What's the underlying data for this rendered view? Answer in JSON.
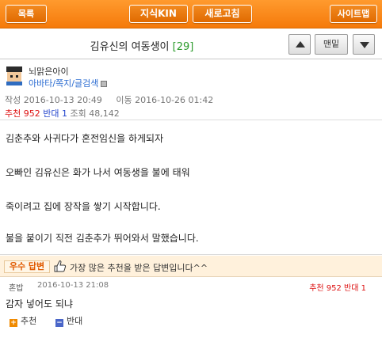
{
  "topbar": {
    "list_label": "목록",
    "kin_label": "지식KIN",
    "refresh_label": "새로고침",
    "sitemap_label": "사이트맵"
  },
  "post": {
    "title": "김유신의 여동생이",
    "comment_count": "[29]",
    "nav_top_label": "맨밑",
    "author": "뇌맑은아이",
    "author_links": "아바타/쪽지/글검색",
    "written_label": "작성",
    "written_date": "2016-10-13 20:49",
    "moved_label": "이동",
    "moved_date": "2016-10-26 01:42",
    "recommend_label": "추천",
    "recommend_count": "952",
    "oppose_label": "반대",
    "oppose_count": "1",
    "views_label": "조회",
    "views_count": "48,142",
    "paragraphs": [
      "김춘추와 사귀다가 혼전임신을 하게되자",
      "오빠인 김유신은 화가 나서 여동생을 불에 태워",
      "죽이려고 집에 장작을 쌓기 시작합니다.",
      "불을 붙이기 직전 김춘추가 뛰어와서 말했습니다."
    ]
  },
  "best": {
    "badge": "우수 답변",
    "text": "가장 많은 추천을 받은 답변입니다^^"
  },
  "reply": {
    "author": "혼밥",
    "date": "2016-10-13 21:08",
    "votes": "추천 952 반대 1",
    "text": "감자 넣어도 되냐",
    "recommend_button": "추천",
    "oppose_button": "반대"
  },
  "colors": {
    "accent": "#f57a0a",
    "recommend": "#dd1111",
    "oppose": "#2244cc",
    "comment_count": "#2a9a2a"
  }
}
